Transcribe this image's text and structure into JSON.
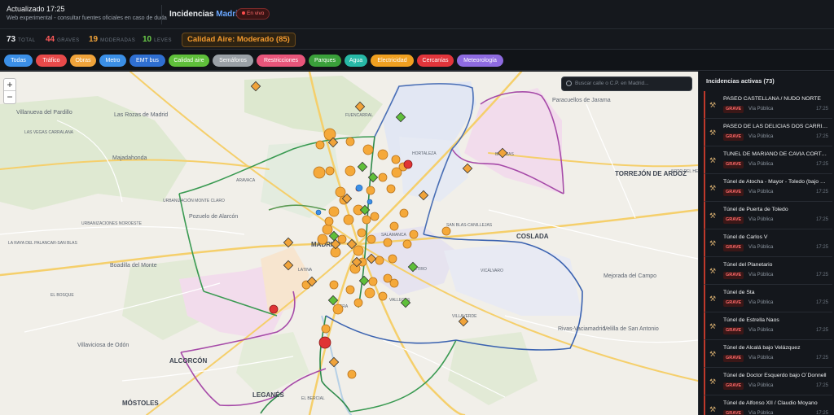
{
  "header": {
    "updated": "Actualizado 17:25",
    "disclaimer": "Web experimental - consultar fuentes oficiales en caso de duda",
    "title_prefix": "Incidencias",
    "title_city": "Madrid",
    "live_label": "En vivo"
  },
  "stats": {
    "total": {
      "value": "73",
      "label": "TOTAL",
      "color": "#e6e8eb"
    },
    "graves": {
      "value": "44",
      "label": "GRAVES",
      "color": "#ff5a5a"
    },
    "moderadas": {
      "value": "19",
      "label": "MODERADAS",
      "color": "#f0a33a"
    },
    "leves": {
      "value": "10",
      "label": "LEVES",
      "color": "#6ccf4a"
    },
    "air_quality": "Calidad Aire: Moderado (85)"
  },
  "filters": [
    {
      "label": "Todas",
      "color": "#3b8fe6"
    },
    {
      "label": "Tráfico",
      "color": "#e84a4a"
    },
    {
      "label": "Obras",
      "color": "#f0a33a"
    },
    {
      "label": "Metro",
      "color": "#3b8fe6"
    },
    {
      "label": "EMT bus",
      "color": "#2f6fd1"
    },
    {
      "label": "Calidad aire",
      "color": "#5fbf3a"
    },
    {
      "label": "Semáforos",
      "color": "#9aa0a6"
    },
    {
      "label": "Restricciones",
      "color": "#e8557a"
    },
    {
      "label": "Parques",
      "color": "#3aa03a"
    },
    {
      "label": "Agua",
      "color": "#27b8a6"
    },
    {
      "label": "Electricidad",
      "color": "#f0a020"
    },
    {
      "label": "Cercanías",
      "color": "#e2353b"
    },
    {
      "label": "Meteorología",
      "color": "#8e6be0"
    }
  ],
  "map": {
    "zoom_in": "+",
    "zoom_out": "−",
    "search_placeholder": "Buscar calle o C.P. en Madrid...",
    "labels": [
      {
        "text": "Villanueva del Pardillo"
      },
      {
        "text": "Las Rozas de Madrid"
      },
      {
        "text": "LAS VEGAS CARRALANA"
      },
      {
        "text": "Majadahonda"
      },
      {
        "text": "ARAVACA"
      },
      {
        "text": "URBANIZACIÓN MONTE CLARO"
      },
      {
        "text": "URBANIZACIONES NOROESTE"
      },
      {
        "text": "Pozuelo de Alarcón"
      },
      {
        "text": "LA RAYA DEL PALANCAR-SAN BLAS"
      },
      {
        "text": "Boadilla del Monte"
      },
      {
        "text": "EL BOSQUE"
      },
      {
        "text": "Villaviciosa de Odón"
      },
      {
        "text": "ALCORCÓN"
      },
      {
        "text": "MÓSTOLES"
      },
      {
        "text": "LEGANÉS"
      },
      {
        "text": "EL BERCIAL"
      },
      {
        "text": "FUENCARRAL"
      },
      {
        "text": "HORTALEZA"
      },
      {
        "text": "Paracuellos de Jarama"
      },
      {
        "text": "BARAJAS"
      },
      {
        "text": "TORREJÓN DE ARDOZ"
      },
      {
        "text": "SOTO DEL HENARES"
      },
      {
        "text": "SAN BLAS-CANILLEJAS"
      },
      {
        "text": "COSLADA"
      },
      {
        "text": "MADRID"
      },
      {
        "text": "LATINA"
      },
      {
        "text": "USERA"
      },
      {
        "text": "VALLECAS"
      },
      {
        "text": "VILLAVERDE"
      },
      {
        "text": "VICÁLVARO"
      },
      {
        "text": "Mejorada del Campo"
      },
      {
        "text": "Velilla de San Antonio"
      },
      {
        "text": "Rivas-Vaciamadrid"
      },
      {
        "text": "RETIRO"
      },
      {
        "text": "SALAMANCA"
      }
    ]
  },
  "panel": {
    "title": "Incidencias activas (73)",
    "incidents": [
      {
        "name": "PASEO CASTELLANA / NUDO NORTE",
        "severity": "GRAVE",
        "category": "Vía Pública",
        "time": "17:25"
      },
      {
        "name": "PASEO DE LAS DELICIAS DOS CARRILES",
        "severity": "GRAVE",
        "category": "Vía Pública",
        "time": "17:25"
      },
      {
        "name": "TÚNEL DE MARIANO DE CAVIA CORTADO",
        "severity": "GRAVE",
        "category": "Vía Pública",
        "time": "17:25"
      },
      {
        "name": "Túnel de Atocha - Mayor - Toledo (bajo Bailén)",
        "severity": "GRAVE",
        "category": "Vía Pública",
        "time": "17:25"
      },
      {
        "name": "Túnel de Puerta de Toledo",
        "severity": "GRAVE",
        "category": "Vía Pública",
        "time": "17:25"
      },
      {
        "name": "Túnel de Carlos V",
        "severity": "GRAVE",
        "category": "Vía Pública",
        "time": "17:25"
      },
      {
        "name": "Túnel del Planetario",
        "severity": "GRAVE",
        "category": "Vía Pública",
        "time": "17:25"
      },
      {
        "name": "Túnel de Sta",
        "severity": "GRAVE",
        "category": "Vía Pública",
        "time": "17:25"
      },
      {
        "name": "Túnel de Estrella Naos",
        "severity": "GRAVE",
        "category": "Vía Pública",
        "time": "17:25"
      },
      {
        "name": "Túnel de Alcalá bajo Velázquez",
        "severity": "GRAVE",
        "category": "Vía Pública",
        "time": "17:25"
      },
      {
        "name": "Túnel de Doctor Esquerdo bajo O´Donnell",
        "severity": "GRAVE",
        "category": "Vía Pública",
        "time": "17:25"
      },
      {
        "name": "Túnel de Alfonso XII / Claudio Moyano",
        "severity": "GRAVE",
        "category": "Vía Pública",
        "time": "17:25"
      }
    ]
  }
}
